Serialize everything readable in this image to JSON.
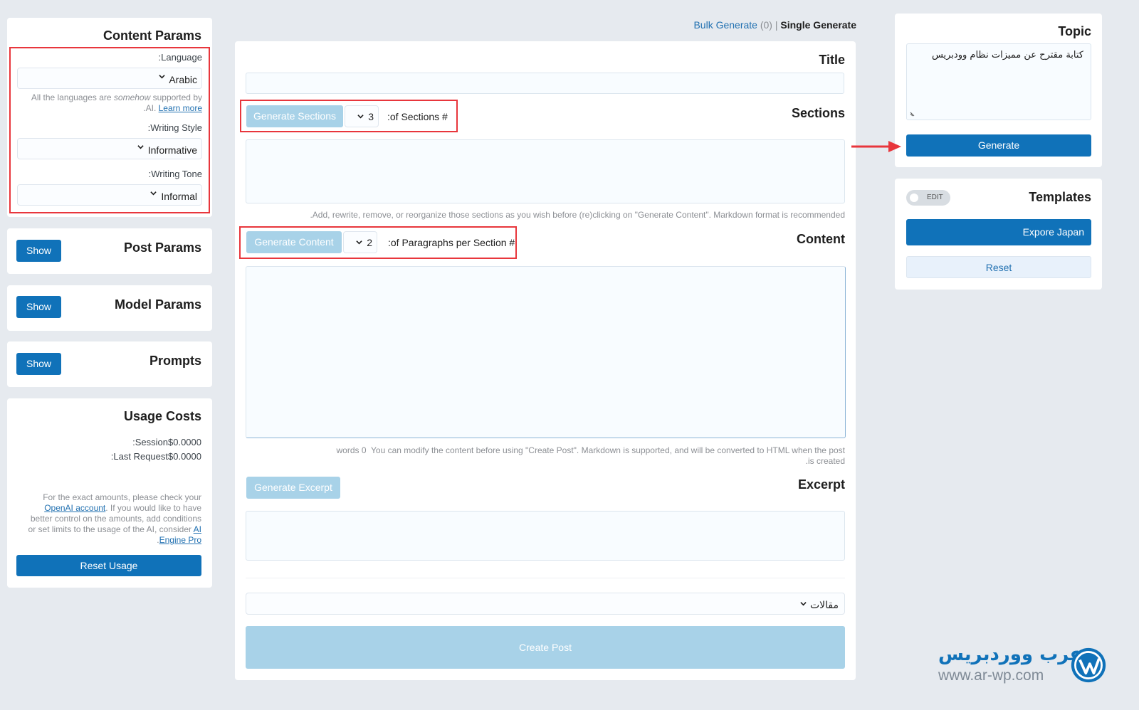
{
  "content_params": {
    "title": "Content Params",
    "language_label": ":Language",
    "language_value": "Arabic",
    "languages_note": "All the languages are",
    "languages_note_em": "somehow",
    "languages_note_tail": "supported by",
    "languages_note_line2": ".AI.",
    "learn_more": "Learn more",
    "writing_style_label": ":Writing Style",
    "writing_style_value": "Informative",
    "writing_tone_label": ":Writing Tone",
    "writing_tone_value": "Informal"
  },
  "post_params": {
    "title": "Post Params",
    "show_label": "Show"
  },
  "model_params": {
    "title": "Model Params",
    "show_label": "Show"
  },
  "prompts": {
    "title": "Prompts",
    "show_label": "Show"
  },
  "usage_costs": {
    "title": "Usage Costs",
    "session": ":Session$0.0000",
    "last_request": ":Last Request$0.0000",
    "note_line1": "For the exact amounts, please check your",
    "note_line2_link": "OpenAI account",
    "note_line2_tail": ". If you would like to have",
    "note_line3": "better control on the amounts, add conditions",
    "note_line4_head": "or set limits to the usage of the AI, consider",
    "note_line4_link": "AI",
    "note_line5_pre": ".",
    "note_line5_link": "Engine Pro",
    "reset_usage": "Reset Usage"
  },
  "mode_tabs": {
    "bulk": "Bulk Generate",
    "bulk_count": "(0)",
    "separator": "|",
    "single": "Single Generate"
  },
  "editor": {
    "title_label": "Title",
    "title_value": "",
    "sections_label": "Sections",
    "generate_sections": "Generate Sections",
    "sections_count": "3",
    "sections_count_label": ":of Sections #",
    "sections_value": "",
    "sections_hint": ".Add, rewrite, remove, or reorganize those sections as you wish before (re)clicking on \"Generate Content\". Markdown format is recommended",
    "content_label": "Content",
    "generate_content": "Generate Content",
    "paragraphs_count": "2",
    "paragraphs_count_label": ":of Paragraphs per Section #",
    "content_value": "",
    "content_hint_words": "words 0",
    "content_hint_line1": "You can modify the content before using \"Create Post\". Markdown is supported, and will be converted to HTML when the post",
    "content_hint_line2": ".is created",
    "excerpt_label": "Excerpt",
    "generate_excerpt": "Generate Excerpt",
    "excerpt_value": "",
    "category_value": "مقالات",
    "create_post": "Create Post"
  },
  "topic": {
    "title": "Topic",
    "value": "كتابة مقترح عن مميزات نظام وودبريس",
    "generate": "Generate"
  },
  "templates": {
    "title": "Templates",
    "edit_toggle": "EDIT",
    "template_item": "Expore Japan",
    "reset": "Reset"
  },
  "watermark": {
    "brand_text": "عرب ووردبريس",
    "url": "www.ar-wp.com"
  },
  "colors": {
    "primary": "#1072b9",
    "primary_light": "#a8d2e8",
    "annotation_red": "#e8363c",
    "background": "#e6eaef"
  }
}
